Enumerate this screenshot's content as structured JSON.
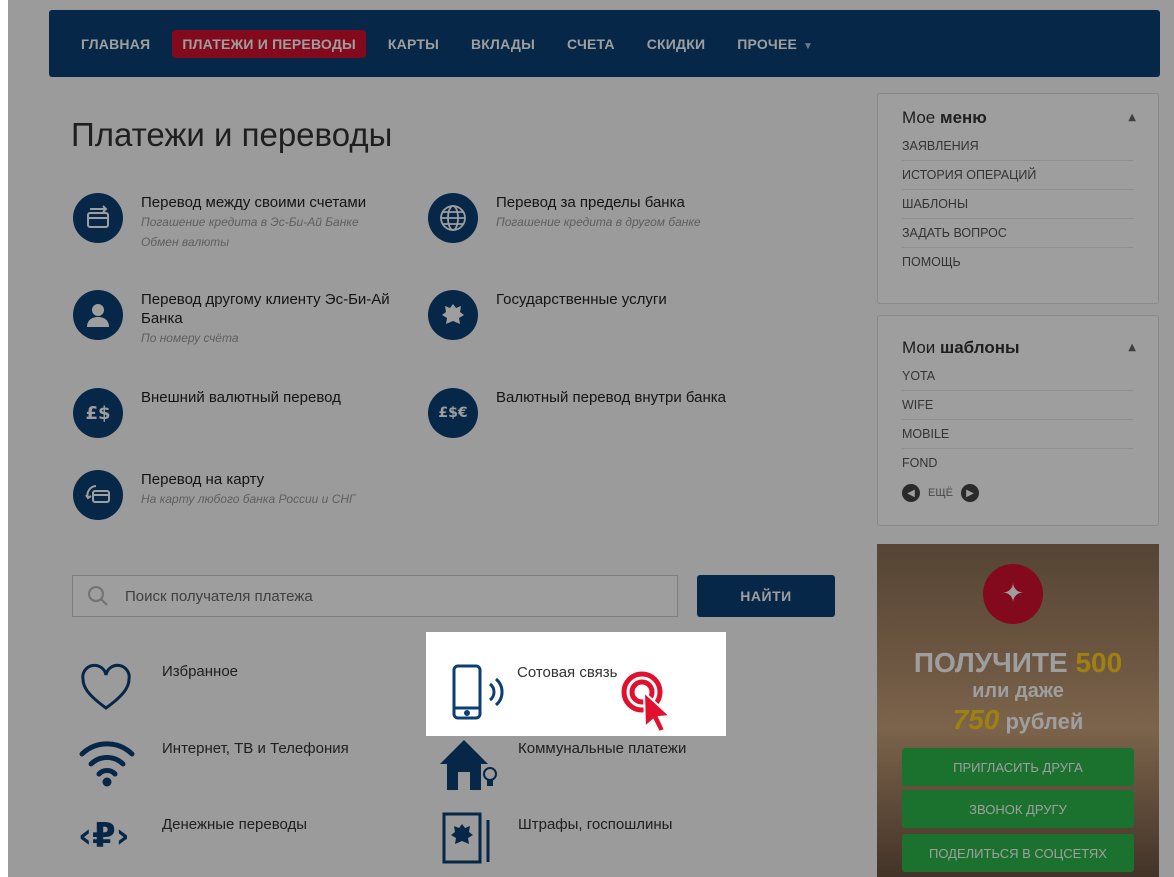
{
  "nav": {
    "items": [
      {
        "label": "ГЛАВНАЯ",
        "active": false
      },
      {
        "label": "ПЛАТЕЖИ И ПЕРЕВОДЫ",
        "active": true
      },
      {
        "label": "КАРТЫ",
        "active": false
      },
      {
        "label": "ВКЛАДЫ",
        "active": false
      },
      {
        "label": "СЧЕТА",
        "active": false
      },
      {
        "label": "СКИДКИ",
        "active": false
      },
      {
        "label": "ПРОЧЕЕ",
        "active": false
      }
    ]
  },
  "page_title": "Платежи и переводы",
  "services": [
    {
      "label": "Перевод между своими счетами",
      "sub": [
        "Погашение кредита в Эс-Би-Ай Банке",
        "Обмен валюты"
      ],
      "icon": "card-transfer-icon"
    },
    {
      "label": "Перевод за пределы банка",
      "sub": [
        "Погашение кредита в другом банке"
      ],
      "icon": "globe-icon"
    },
    {
      "label": "Перевод другому клиенту Эс-Би-Ай Банка",
      "sub": [
        "По номеру счёта"
      ],
      "icon": "person-icon"
    },
    {
      "label": "Государственные услуги",
      "sub": [],
      "icon": "coat-of-arms-icon"
    },
    {
      "label": "Внешний валютный перевод",
      "sub": [],
      "icon": "currency-icon"
    },
    {
      "label": "Валютный перевод внутри банка",
      "sub": [],
      "icon": "currency-exchange-icon"
    },
    {
      "label": "Перевод на карту",
      "sub": [
        "На карту любого банка России и СНГ"
      ],
      "icon": "card-refresh-icon"
    }
  ],
  "search": {
    "placeholder": "Поиск получателя платежа",
    "button": "НАЙТИ"
  },
  "categories": [
    {
      "label": "Избранное",
      "icon": "heart-icon"
    },
    {
      "label": "Сотовая связь",
      "icon": "mobile-phone-icon"
    },
    {
      "label": "Интернет, ТВ и Телефония",
      "icon": "wifi-icon"
    },
    {
      "label": "Коммунальные платежи",
      "icon": "house-icon"
    },
    {
      "label": "Денежные переводы",
      "icon": "ruble-icon"
    },
    {
      "label": "Штрафы, госпошлины",
      "icon": "document-coat-icon"
    }
  ],
  "my_menu": {
    "title_light": "Мое",
    "title_bold": "меню",
    "items": [
      "ЗАЯВЛЕНИЯ",
      "ИСТОРИЯ ОПЕРАЦИЙ",
      "ШАБЛОНЫ",
      "ЗАДАТЬ ВОПРОС",
      "ПОМОЩЬ"
    ]
  },
  "my_templates": {
    "title_light": "Мои",
    "title_bold": "шаблоны",
    "items": [
      "YOTA",
      "WIFE",
      "MOBILE",
      "FOND"
    ],
    "more": "ЕЩЁ"
  },
  "promo": {
    "line1": "ПОЛУЧИТЕ",
    "line1_amount": "500",
    "line2": "или даже",
    "line3_amount": "750",
    "line3": "рублей",
    "buttons": [
      "ПРИГЛАСИТЬ ДРУГА",
      "ЗВОНОК ДРУГУ",
      "ПОДЕЛИТЬСЯ В СОЦСЕТЯХ"
    ]
  },
  "colors": {
    "brand_blue": "#0b3f73",
    "accent_red": "#d4102e",
    "promo_green": "#2db84d",
    "promo_yellow": "#ffd11a"
  }
}
